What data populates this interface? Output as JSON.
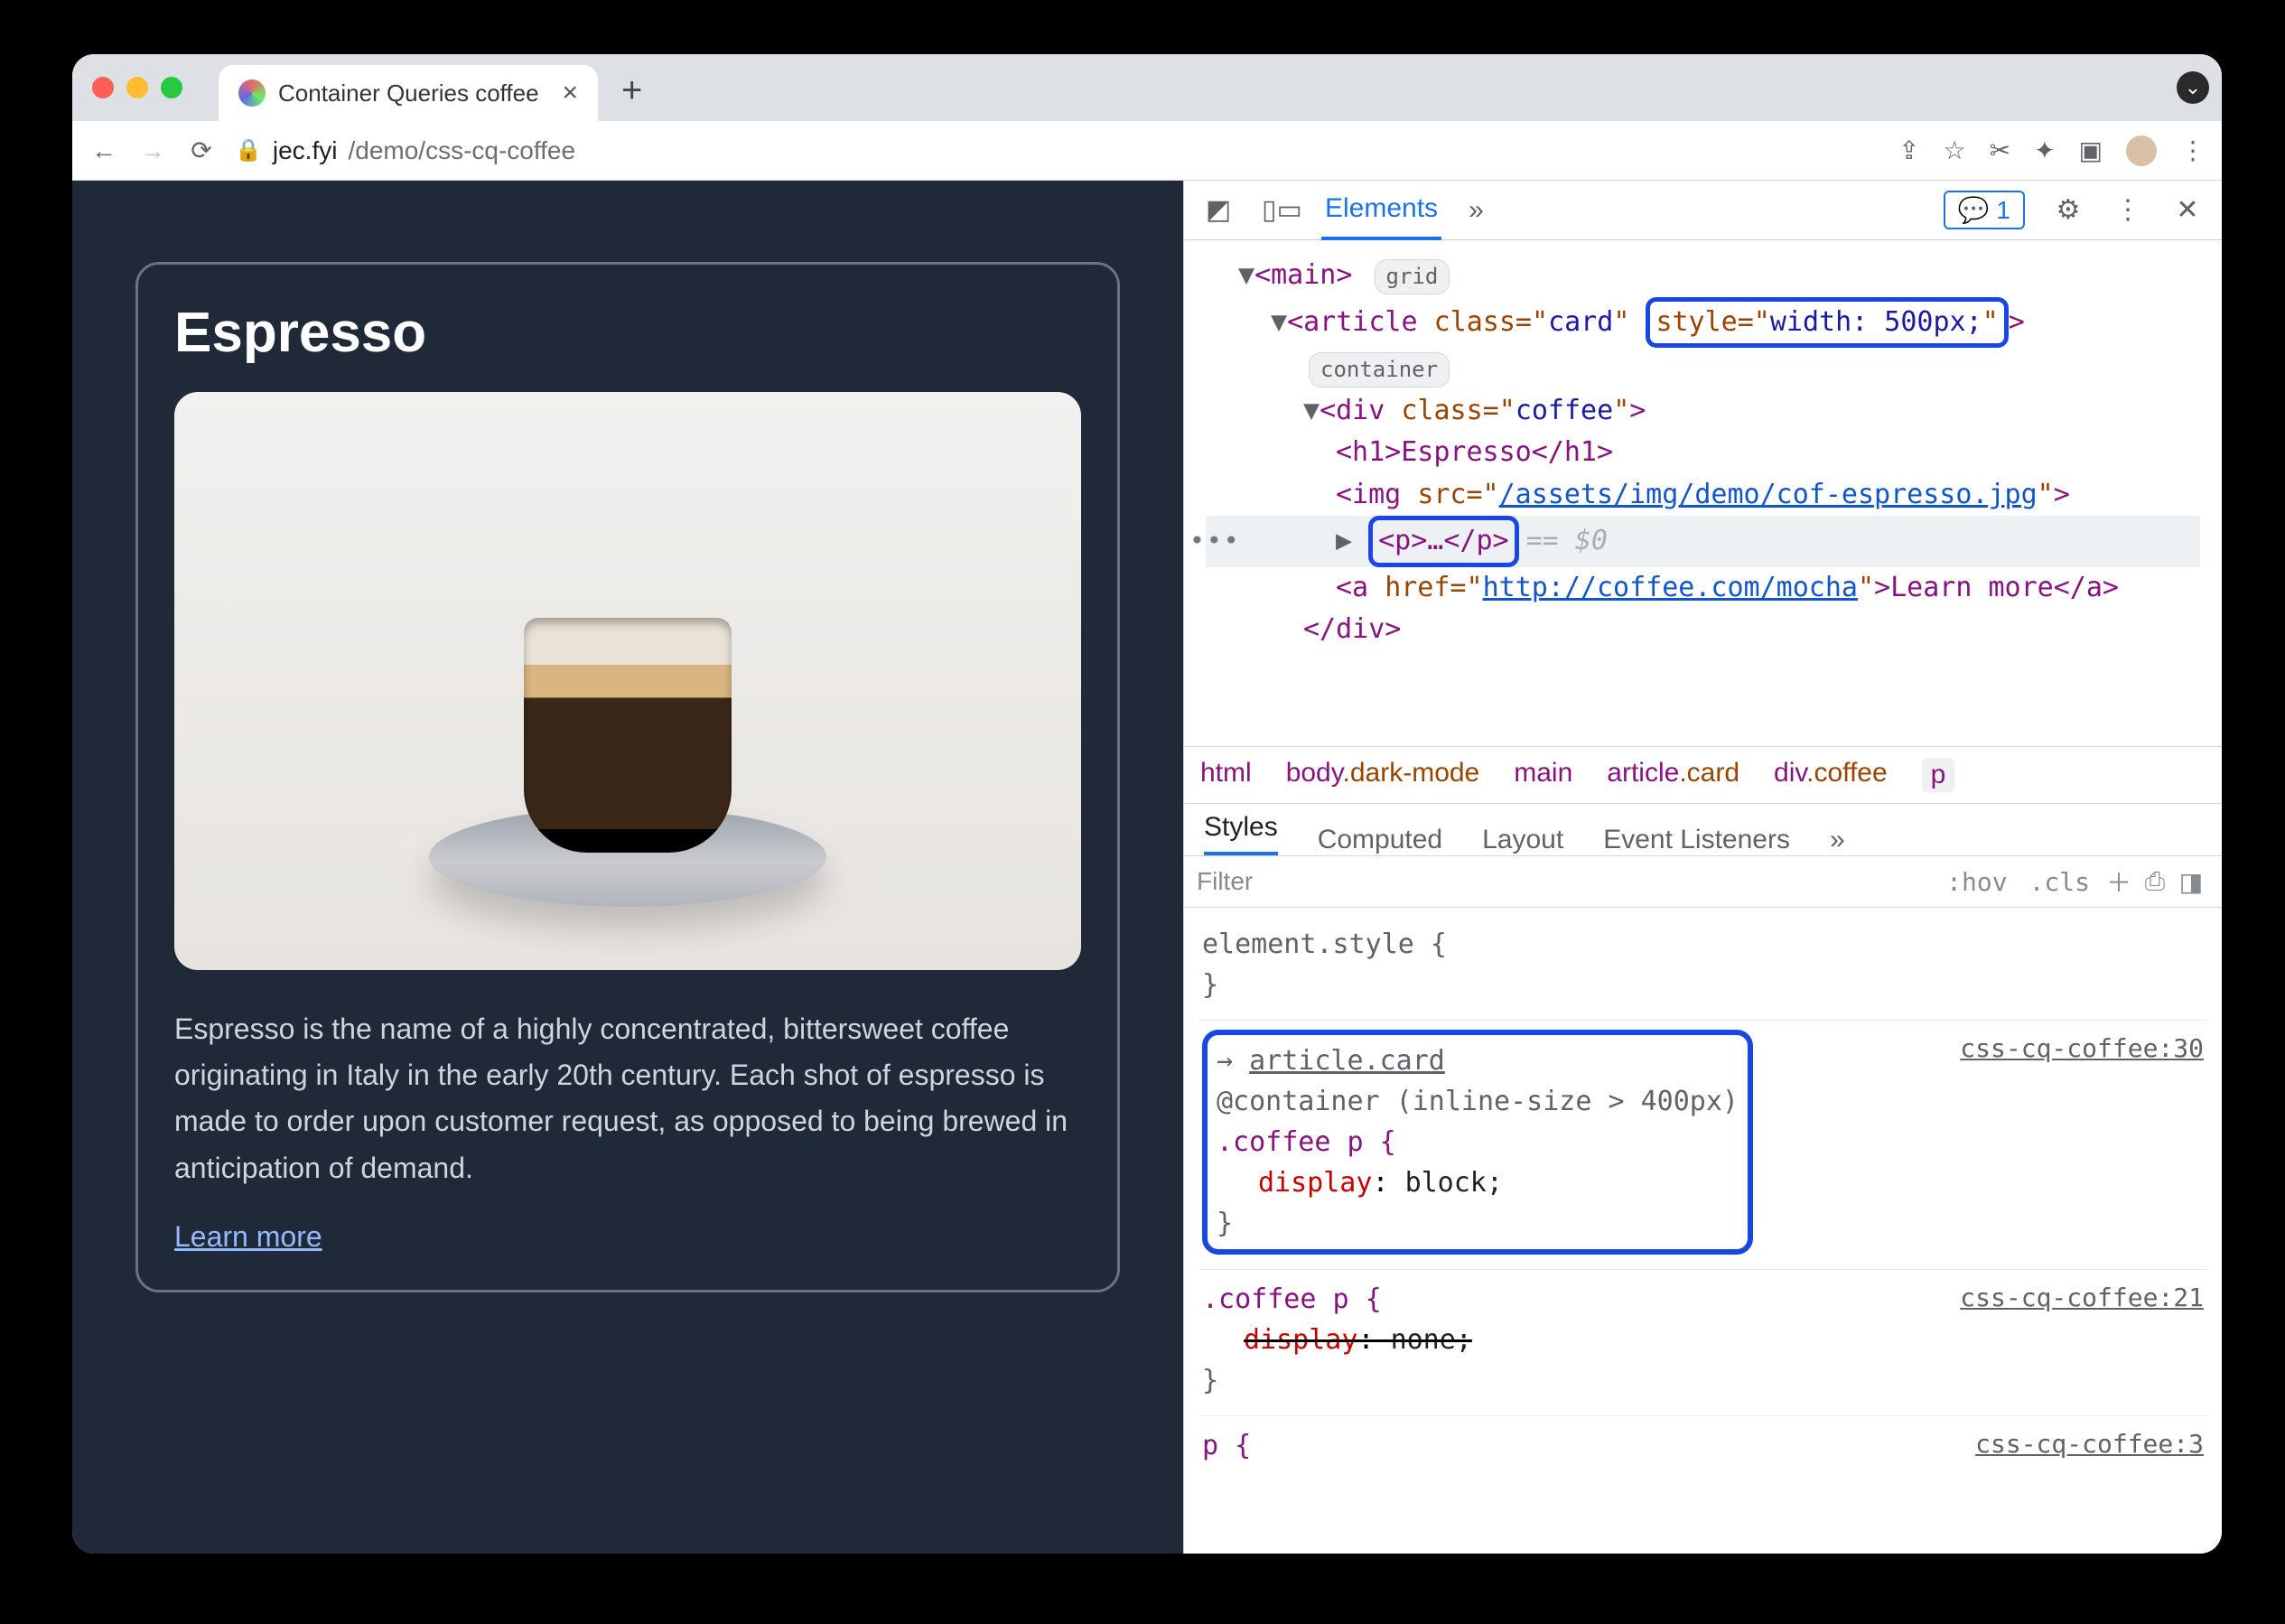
{
  "browser": {
    "tab_title": "Container Queries coffee",
    "new_tab_icon": "+",
    "url": {
      "host": "jec.fyi",
      "path": "/demo/css-cq-coffee"
    }
  },
  "page": {
    "heading": "Espresso",
    "description": "Espresso is the name of a highly concentrated, bittersweet coffee originating in Italy in the early 20th century. Each shot of espresso is made to order upon customer request, as opposed to being brewed in anticipation of demand.",
    "learn_more": "Learn more"
  },
  "devtools": {
    "tabs": {
      "elements": "Elements",
      "more": "»",
      "issues_count": "1"
    },
    "elements": {
      "main_open": "<main>",
      "main_badge": "grid",
      "article_open_pre": "<article class=\"",
      "article_class": "card",
      "article_open_mid": "\" ",
      "article_style": "style=\"width: 500px;\"",
      "article_open_post": ">",
      "container_badge": "container",
      "div_open": "<div class=\"",
      "div_class": "coffee",
      "div_open_post": "\">",
      "h1": "<h1>Espresso</h1>",
      "img_pre": "<img src=\"",
      "img_src": "/assets/img/demo/cof-espresso.jpg",
      "img_post": "\">",
      "p_collapsed": "<p>…</p>",
      "eq0": "== $0",
      "a_pre": "<a href=\"",
      "a_href": "http://coffee.com/mocha",
      "a_mid": "\">Learn more</a>",
      "div_close": "</div>"
    },
    "crumbs": {
      "c1": "html",
      "c2a": "body",
      "c2b": ".dark-mode",
      "c3": "main",
      "c4a": "article",
      "c4b": ".card",
      "c5a": "div",
      "c5b": ".coffee",
      "c6": "p"
    },
    "styles_tabs": {
      "styles": "Styles",
      "computed": "Computed",
      "layout": "Layout",
      "listeners": "Event Listeners",
      "more": "»"
    },
    "stylebar": {
      "filter": "Filter",
      "hov": ":hov",
      "cls": ".cls"
    },
    "rules": {
      "elstyle_open": "element.style {",
      "close": "}",
      "r1_arrow": "→",
      "r1_context": "article.card",
      "r1_at": "@container (inline-size > 400px)",
      "r1_sel": ".coffee p {",
      "r1_prop": "display",
      "r1_val": "block;",
      "r1_src": "css-cq-coffee:30",
      "r2_sel": ".coffee p {",
      "r2_prop": "display",
      "r2_val": "none;",
      "r2_src": "css-cq-coffee:21",
      "r3_sel": "p {",
      "r3_src": "css-cq-coffee:3"
    }
  }
}
